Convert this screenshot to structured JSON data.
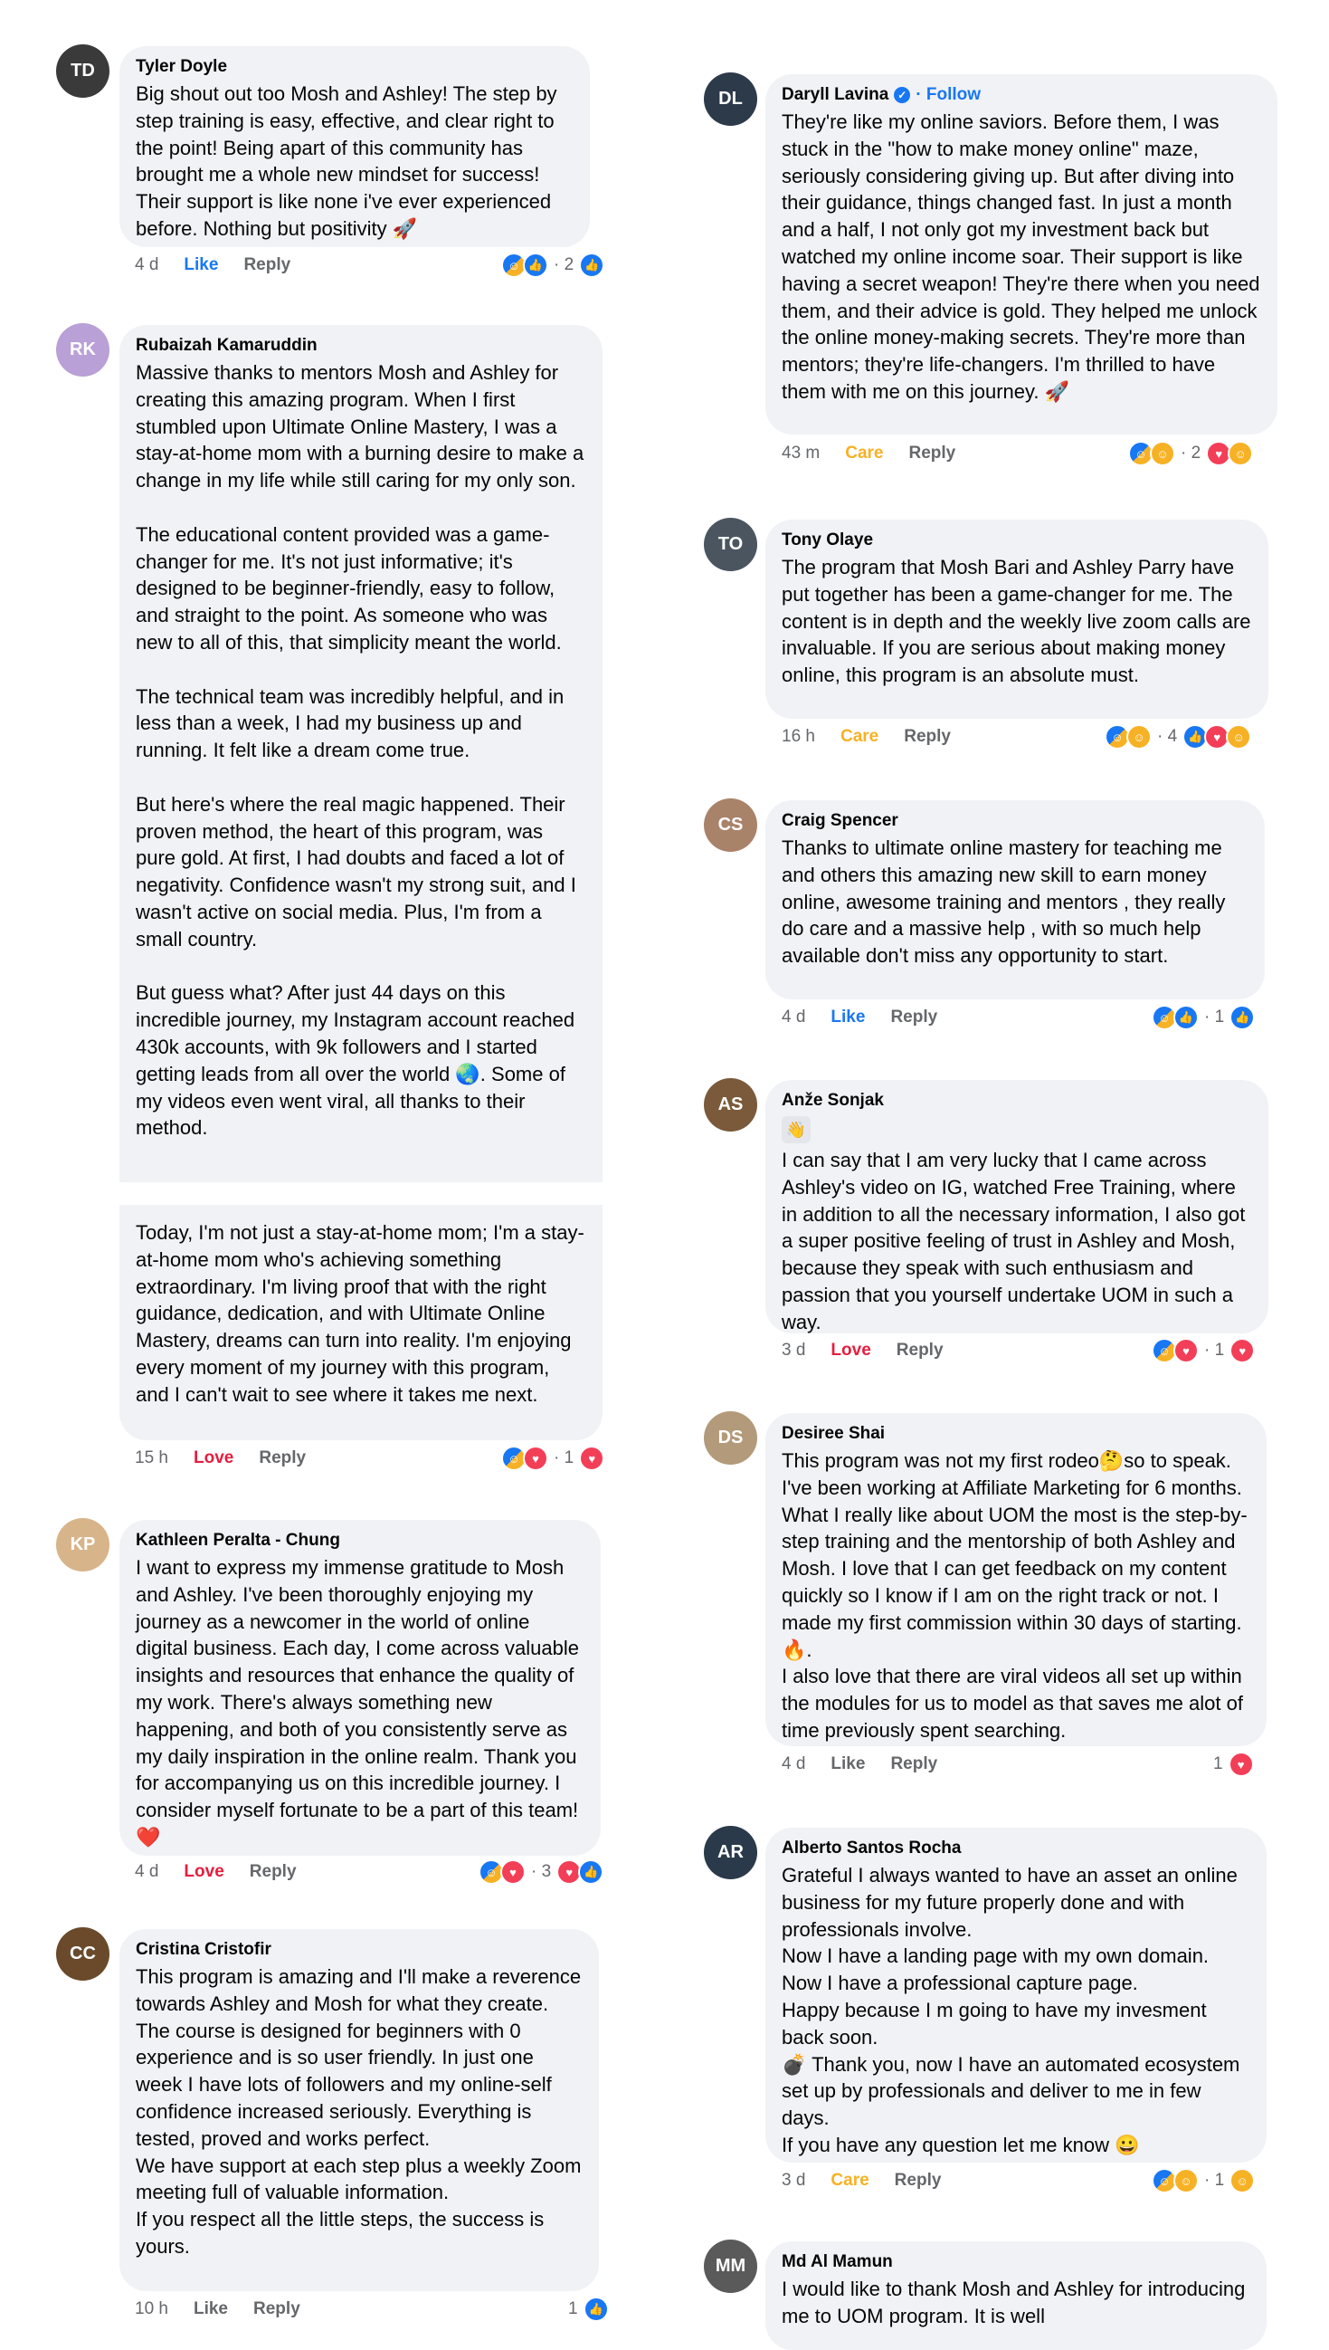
{
  "left": [
    {
      "name": "Tyler Doyle",
      "text": "Big shout out too Mosh and Ashley! The step by step training is easy, effective, and clear right to the point! Being apart of this community has brought me a whole new mindset for success! Their support is like none i've ever experienced before. Nothing but positivity 🚀",
      "time": "4 d",
      "action": "Like",
      "reply": "Reply",
      "count": "· 2"
    },
    {
      "name": "Rubaizah Kamaruddin",
      "text": "Massive thanks to mentors Mosh and Ashley for creating this amazing program. When I first stumbled upon Ultimate Online Mastery, I was a stay-at-home mom with a burning desire to make a change in my life while still caring for my only son.\n\nThe educational content provided was a game-changer for me. It's not just informative; it's designed to be beginner-friendly, easy to follow, and straight to the point. As someone who was new to all of this, that simplicity meant the world.\n\nThe technical team was incredibly helpful, and in less than a week, I had my business up and running. It felt like a dream come true.\n\nBut here's where the real magic happened. Their proven method, the heart of this program, was pure gold. At first, I had doubts and faced a lot of negativity. Confidence wasn't my strong suit, and I wasn't active on social media. Plus, I'm from a small country.\n\nBut guess what? After just 44 days on this incredible journey, my Instagram account reached 430k accounts, with 9k followers and I started getting leads from all over the world 🌏. Some of my videos even went viral, all thanks to their method.",
      "text2": "Today, I'm not just a stay-at-home mom; I'm a stay-at-home mom who's achieving something extraordinary. I'm living proof that with the right guidance, dedication, and with Ultimate Online Mastery, dreams can turn into reality. I'm enjoying every moment of my journey with this program, and I can't wait to see where it takes me next.",
      "time": "15 h",
      "action": "Love",
      "reply": "Reply",
      "count": "· 1"
    },
    {
      "name": "Kathleen Peralta - Chung",
      "text": "I want to express my immense gratitude to Mosh and Ashley. I've been thoroughly enjoying my journey as a newcomer in the world of online digital business. Each day, I come across valuable insights and resources that enhance the quality of my work. There's always something new happening, and both of you consistently serve as my daily inspiration in the online realm. Thank you for accompanying us on this incredible journey. I consider myself fortunate to be a part of this team! ❤️",
      "time": "4 d",
      "action": "Love",
      "reply": "Reply",
      "count": "· 3"
    },
    {
      "name": "Cristina Cristofir",
      "text": "This program is amazing and I'll make a reverence towards Ashley and Mosh for what they create. The course is designed for beginners with 0 experience and is so user friendly. In just one week I have lots of followers and my online-self confidence increased seriously. Everything is tested, proved and works perfect.\nWe have support at each step plus a weekly Zoom meeting full of valuable information.\nIf you respect all the little steps, the success is yours.",
      "time": "10 h",
      "action": "Like",
      "reply": "Reply",
      "count": "1"
    }
  ],
  "right": [
    {
      "name": "Daryll Lavina",
      "follow": "· Follow",
      "text": "They're like my online saviors. Before them, I was stuck in the \"how to make money online\" maze, seriously considering giving up. But after diving into their guidance, things changed fast. In just a month and a half, I not only got my investment back but watched my online income soar. Their support is like having a secret weapon! They're there when you need them, and their advice is gold. They helped me unlock the online money-making secrets. They're more than mentors; they're life-changers. I'm thrilled to have them with me on this journey. 🚀",
      "time": "43 m",
      "action": "Care",
      "reply": "Reply",
      "count": "· 2"
    },
    {
      "name": "Tony Olaye",
      "text": "The program that Mosh Bari and Ashley Parry have put together has been a game-changer for me. The content is in depth and the weekly live zoom calls are invaluable. If you are serious about making money online, this program is an absolute must.",
      "time": "16 h",
      "action": "Care",
      "reply": "Reply",
      "count": "· 4"
    },
    {
      "name": "Craig Spencer",
      "text": "Thanks to ultimate online mastery  for teaching me and others this amazing new skill to earn money online, awesome training and mentors , they really do care and a massive help , with so much help available  don't miss any opportunity to start.",
      "time": "4 d",
      "action": "Like",
      "reply": "Reply",
      "count": "· 1"
    },
    {
      "name": "Anže Sonjak",
      "text": "I can say that I am very lucky that I came across Ashley's video on IG, watched Free Training, where in addition to all the necessary information, I also got a super positive feeling of trust in Ashley and Mosh, because they speak with such enthusiasm and passion that you yourself undertake UOM in such a way.",
      "time": "3 d",
      "action": "Love",
      "reply": "Reply",
      "count": "· 1"
    },
    {
      "name": "Desiree Shai",
      "text": "This program was not my first rodeo🤔so to speak. I've been working at Affiliate Marketing for 6 months.  What I really like about UOM the most is the step-by-step training and the mentorship of both Ashley and Mosh.  I love that I can get feedback on my content quickly so I know if I am on the right track or not.  I made my first commission within 30 days of starting.  🔥.\nI also love that there are viral videos all set up within the modules for us to model as that saves me alot of time previously spent searching.",
      "time": "4 d",
      "action": "Like",
      "reply": "Reply",
      "count": "1"
    },
    {
      "name": "Alberto Santos Rocha",
      "text": "Grateful I always wanted to have an asset an online business for my future properly done and with professionals involve.\nNow I have a landing page with my own domain.\nNow I have a professional capture page.\nHappy because I m going to have my invesment back soon.\n💣 Thank you, now I have an automated ecosystem set up by professionals and deliver to me in few days.\nIf you have any question let me know 😀",
      "time": "3 d",
      "action": "Care",
      "reply": "Reply",
      "count": "· 1"
    },
    {
      "name": "Md Al Mamun",
      "text": "I would like to thank Mosh and Ashley for introducing me to UOM program. It is well"
    }
  ]
}
